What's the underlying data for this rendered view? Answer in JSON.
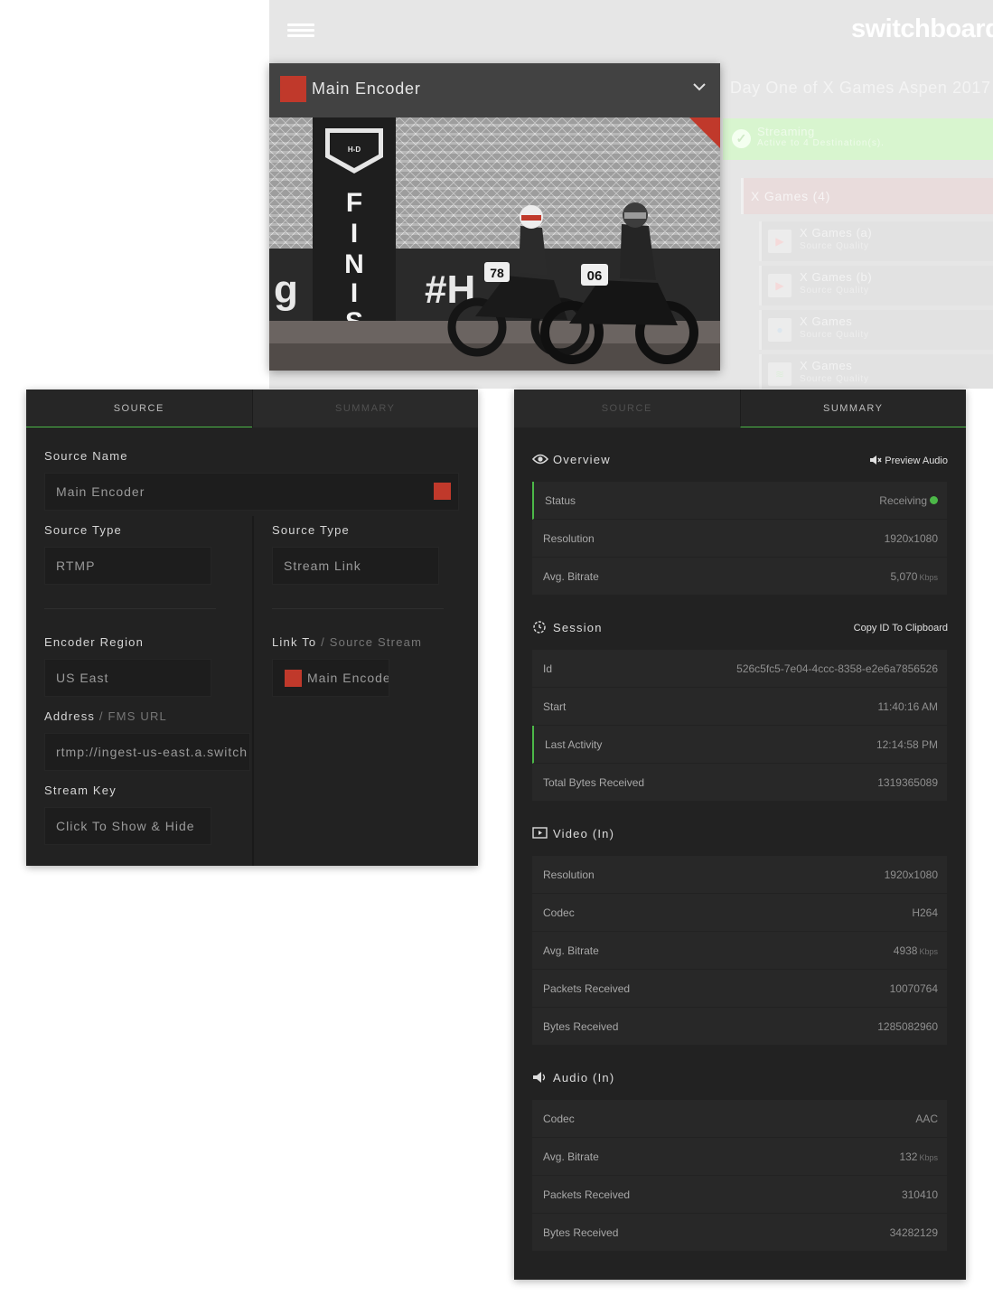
{
  "app": {
    "logo": "switchboard",
    "event_title": "Day One of X Games Aspen 2017"
  },
  "streaming": {
    "title": "Streaming",
    "subtitle": "Active to 4 Destination(s)."
  },
  "destinations": {
    "group_label": "X Games (4)",
    "items": [
      {
        "name": "X Games (a)",
        "quality": "Source Quality",
        "icon": "youtube-icon"
      },
      {
        "name": "X Games (b)",
        "quality": "Source Quality",
        "icon": "youtube-icon"
      },
      {
        "name": "X Games",
        "quality": "Source Quality",
        "icon": "periscope-icon"
      },
      {
        "name": "X Games",
        "quality": "Source Quality",
        "icon": "stream-icon"
      }
    ]
  },
  "encoder": {
    "title": "Main Encoder",
    "color": "#c0392b"
  },
  "source_panel": {
    "tabs": [
      "SOURCE",
      "SUMMARY"
    ],
    "source_name_label": "Source Name",
    "source_name_value": "Main Encoder",
    "source_type_label": "Source Type",
    "source_type_value": "RTMP",
    "source_type_label_2": "Source Type",
    "source_type_value_2": "Stream Link",
    "encoder_region_label": "Encoder Region",
    "encoder_region_value": "US East",
    "link_to_label": "Link To",
    "link_to_label_sub": "/ Source Stream",
    "link_to_value": "Main Encoder",
    "address_label": "Address",
    "address_label_sub": "/ FMS URL",
    "address_value": "rtmp://ingest-us-east.a.switch",
    "stream_key_label": "Stream Key",
    "stream_key_value": "Click To Show & Hide"
  },
  "summary_panel": {
    "tabs": [
      "SOURCE",
      "SUMMARY"
    ],
    "overview": {
      "title": "Overview",
      "action": "Preview Audio",
      "rows": [
        {
          "label": "Status",
          "value": "Receiving"
        },
        {
          "label": "Resolution",
          "value": "1920x1080"
        },
        {
          "label": "Avg. Bitrate",
          "value": "5,070",
          "unit": "Kbps"
        }
      ]
    },
    "session": {
      "title": "Session",
      "action": "Copy ID To Clipboard",
      "rows": [
        {
          "label": "Id",
          "value": "526c5fc5-7e04-4ccc-8358-e2e6a7856526"
        },
        {
          "label": "Start",
          "value": "11:40:16 AM"
        },
        {
          "label": "Last Activity",
          "value": "12:14:58 PM"
        },
        {
          "label": "Total Bytes Received",
          "value": "1319365089"
        }
      ]
    },
    "video": {
      "title": "Video (In)",
      "rows": [
        {
          "label": "Resolution",
          "value": "1920x1080"
        },
        {
          "label": "Codec",
          "value": "H264"
        },
        {
          "label": "Avg. Bitrate",
          "value": "4938",
          "unit": "Kbps"
        },
        {
          "label": "Packets Received",
          "value": "10070764"
        },
        {
          "label": "Bytes Received",
          "value": "1285082960"
        }
      ]
    },
    "audio": {
      "title": "Audio (In)",
      "rows": [
        {
          "label": "Codec",
          "value": "AAC"
        },
        {
          "label": "Avg. Bitrate",
          "value": "132",
          "unit": "Kbps"
        },
        {
          "label": "Packets Received",
          "value": "310410"
        },
        {
          "label": "Bytes Received",
          "value": "34282129"
        }
      ]
    }
  },
  "colors": {
    "accent_green": "#4cb848",
    "encoder_red": "#c0392b",
    "panel_bg": "#222222"
  }
}
